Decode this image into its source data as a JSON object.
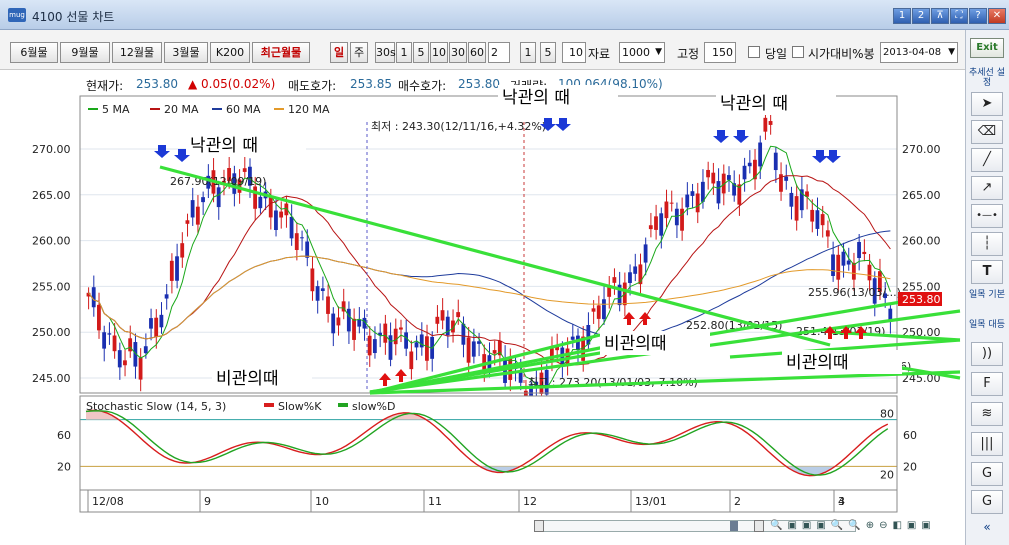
{
  "window": {
    "title": "4100 선물 차트",
    "logo": "mug",
    "buttons": [
      "1",
      "2",
      "⊼",
      "⛶",
      "?",
      "✕"
    ]
  },
  "toolbar": {
    "months": [
      "6월물",
      "9월물",
      "12월물",
      "3월물",
      "K200",
      "최근월물"
    ],
    "period": [
      "일",
      "주"
    ],
    "minutes": [
      "30s",
      "1",
      "5",
      "10",
      "30",
      "60"
    ],
    "min_value": "2",
    "ticks": [
      "1",
      "5"
    ],
    "tick_value": "10",
    "data_label": "자료",
    "data_value": "1000",
    "fixed_label": "고정",
    "fixed_value": "150",
    "today_label": "당일",
    "compare_label": "시가대비%봉",
    "date_value": "2013-04-08"
  },
  "sidebar": {
    "exit_label": "Exit",
    "trend_label": "추세선 설정",
    "daily_basic": "일목 기본",
    "daily_large": "일목 대등",
    "tools": [
      "cursor-icon",
      "eraser-icon",
      "line-icon",
      "arrow-line-icon",
      "horizontal-line-icon",
      "vertical-line-icon",
      "text-icon"
    ],
    "tool_glyphs": [
      "➤",
      "⌫",
      "╱",
      "↗",
      "•—•",
      "┆",
      "T"
    ],
    "lower_glyphs": [
      "))",
      "F",
      "≋",
      "|||",
      "G",
      "G"
    ],
    "collapse": "«"
  },
  "info": {
    "current_label": "현재가:",
    "current_value": "253.80",
    "change": "▲ 0.05(0.02%)",
    "ask_label": "매도호가:",
    "ask_value": "253.85",
    "bid_label": "매수호가:",
    "bid_value": "253.80",
    "volume_label": "거래량:",
    "volume_value": "100,064(98.10%)"
  },
  "legend": [
    {
      "name": "5 MA",
      "color": "#1aa81a"
    },
    {
      "name": "20 MA",
      "color": "#b81414"
    },
    {
      "name": "60 MA",
      "color": "#1f3c9c"
    },
    {
      "name": "120 MA",
      "color": "#e39a2a"
    }
  ],
  "current_price_tag": "253.80",
  "chart_data": [
    {
      "type": "candlestick",
      "y_ticks": [
        "270.00",
        "265.00",
        "260.00",
        "255.00",
        "250.00",
        "245.00"
      ],
      "ylim": [
        243,
        274
      ],
      "x_ticks": [
        "12/08",
        "9",
        "10",
        "11",
        "12",
        "13/01",
        "2",
        "3",
        "4"
      ],
      "annotations": {
        "low": "최저 : 243.30(12/11/16,+4.32%)",
        "high": "최고 : 273.20(13/01/03,-7.10%)",
        "labels": [
          "267.90(12/09/19)",
          "252.80(13/02/15)",
          "255.96(13/03/...)",
          "251.4(13/03/19)"
        ],
        "pessimism_text": "낙관의 때",
        "optimism_text": "비관의때",
        "right_cut": "6)"
      },
      "colors": {
        "up": "#d21a1a",
        "down": "#1a2fb0",
        "trendline": "#39e039",
        "down_arrow": "#1c39d6",
        "up_arrow": "#e01010"
      }
    },
    {
      "type": "line",
      "title": "Stochastic Slow (14, 5, 3)",
      "series": [
        {
          "name": "Slow%K",
          "color": "#d81e1e"
        },
        {
          "name": "slow%D",
          "color": "#22a422"
        }
      ],
      "y_ticks_left": [
        "60",
        "20"
      ],
      "y_ticks_right": [
        "60",
        "20"
      ],
      "levels": [
        "80",
        "20"
      ],
      "ylim": [
        0,
        100
      ]
    }
  ]
}
